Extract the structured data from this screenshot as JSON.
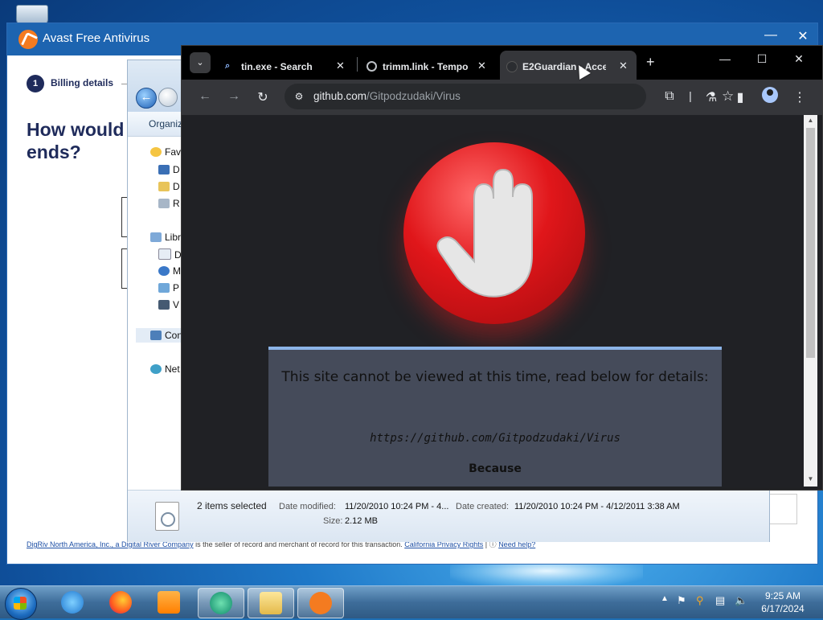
{
  "avast": {
    "title": "Avast Free Antivirus",
    "step_number": "1",
    "step_label": "Billing details",
    "headline": "How would ends?",
    "footer_company": "DigRiv North America, Inc., a Digital River Company",
    "footer_text": "is the seller of record and merchant of record for this transaction.",
    "footer_privacy": "California Privacy Rights",
    "footer_sep": "|",
    "footer_help": "Need help?"
  },
  "explorer": {
    "organize_label": "Organiz",
    "tree": {
      "favorites": "Fav",
      "fav_items": [
        "D",
        "D",
        "R"
      ],
      "libraries": "Libr",
      "lib_items": [
        "D",
        "M",
        "P",
        "V"
      ],
      "computer": "Con",
      "network": "Net"
    },
    "status": {
      "count": "2 items selected",
      "date_modified_label": "Date modified:",
      "date_modified_value": "11/20/2010 10:24 PM - 4...",
      "date_created_label": "Date created:",
      "date_created_value": "11/20/2010 10:24 PM - 4/12/2011 3:38 AM",
      "size_label": "Size:",
      "size_value": "2.12 MB"
    }
  },
  "chrome": {
    "tabs": [
      {
        "title": "tin.exe - Search",
        "icon": "search-icon",
        "active": false
      },
      {
        "title": "trimm.link - Tempo",
        "icon": "globe-icon",
        "active": false
      },
      {
        "title": "E2Guardian - Acces",
        "icon": "github-icon",
        "active": true
      }
    ],
    "url_domain": "github.com",
    "url_path": "/Gitpodzudaki/Virus",
    "block_message_title": "This site cannot be viewed at this time, read below for details:",
    "block_url": "https://github.com/Gitpodzudaki/Virus",
    "block_because": "Because",
    "colors": {
      "block_box": "#454b5a",
      "block_border": "#8cb4e8",
      "stop_red": "#e0161a"
    }
  },
  "taskbar": {
    "apps": [
      "internet-explorer",
      "firefox",
      "media-player",
      "browser",
      "file-explorer",
      "avast"
    ],
    "clock_time": "9:25 AM",
    "clock_date": "6/17/2024"
  }
}
